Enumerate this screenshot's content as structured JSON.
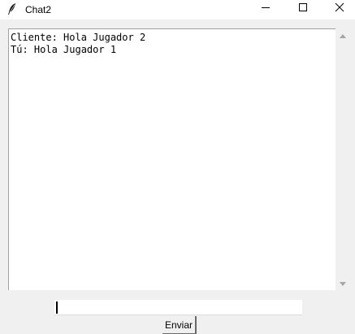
{
  "window": {
    "title": "Chat2",
    "app_icon": "feather-icon",
    "controls": [
      "minimize-icon",
      "maximize-icon",
      "close-icon"
    ]
  },
  "chat": {
    "lines": [
      "Cliente: Hola Jugador 2",
      "Tú: Hola Jugador 1"
    ]
  },
  "input": {
    "value": "",
    "placeholder": ""
  },
  "send_button": {
    "label": "Enviar"
  }
}
